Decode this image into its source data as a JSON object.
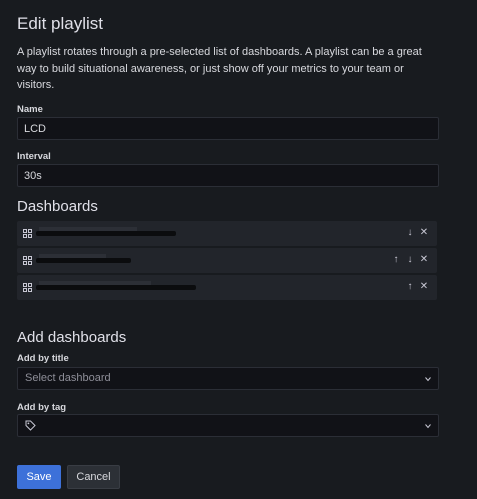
{
  "page": {
    "title": "Edit playlist",
    "description": "A playlist rotates through a pre-selected list of dashboards. A playlist can be a great way to build situational awareness, or just show off your metrics to your team or visitors."
  },
  "form": {
    "name_label": "Name",
    "name_value": "LCD",
    "interval_label": "Interval",
    "interval_value": "30s"
  },
  "dashboards": {
    "title": "Dashboards",
    "items": [
      {
        "icon": "dashboard-grid-icon",
        "controls": [
          "arrow-down",
          "remove"
        ]
      },
      {
        "icon": "dashboard-grid-icon",
        "controls": [
          "arrow-up",
          "arrow-down",
          "remove"
        ]
      },
      {
        "icon": "dashboard-grid-icon",
        "controls": [
          "arrow-up",
          "remove"
        ]
      }
    ]
  },
  "add": {
    "title": "Add dashboards",
    "by_title_label": "Add by title",
    "by_title_placeholder": "Select dashboard",
    "by_tag_label": "Add by tag"
  },
  "buttons": {
    "save": "Save",
    "cancel": "Cancel"
  },
  "colors": {
    "background": "#181b1f",
    "primary": "#3d71d9",
    "row": "#22252b"
  }
}
